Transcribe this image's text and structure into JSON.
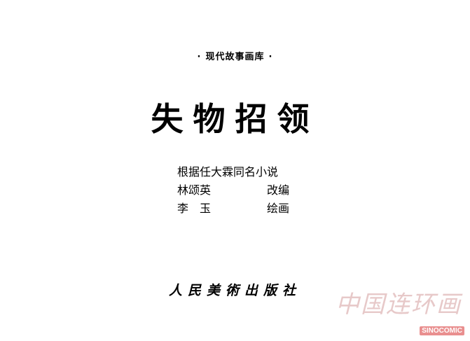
{
  "page": {
    "series_dot": "·",
    "series_name": "现代故事画库",
    "title": "失物招领",
    "credits": {
      "source": "根据任大霖同名小说",
      "adapter": {
        "name": "林颂英",
        "role": "改编"
      },
      "illustrator": {
        "name": "李　玉",
        "role": "绘画"
      }
    },
    "publisher": "人民美術出版社"
  },
  "watermark": {
    "text": "中国连环画",
    "badge": "SINOCOMIC"
  }
}
